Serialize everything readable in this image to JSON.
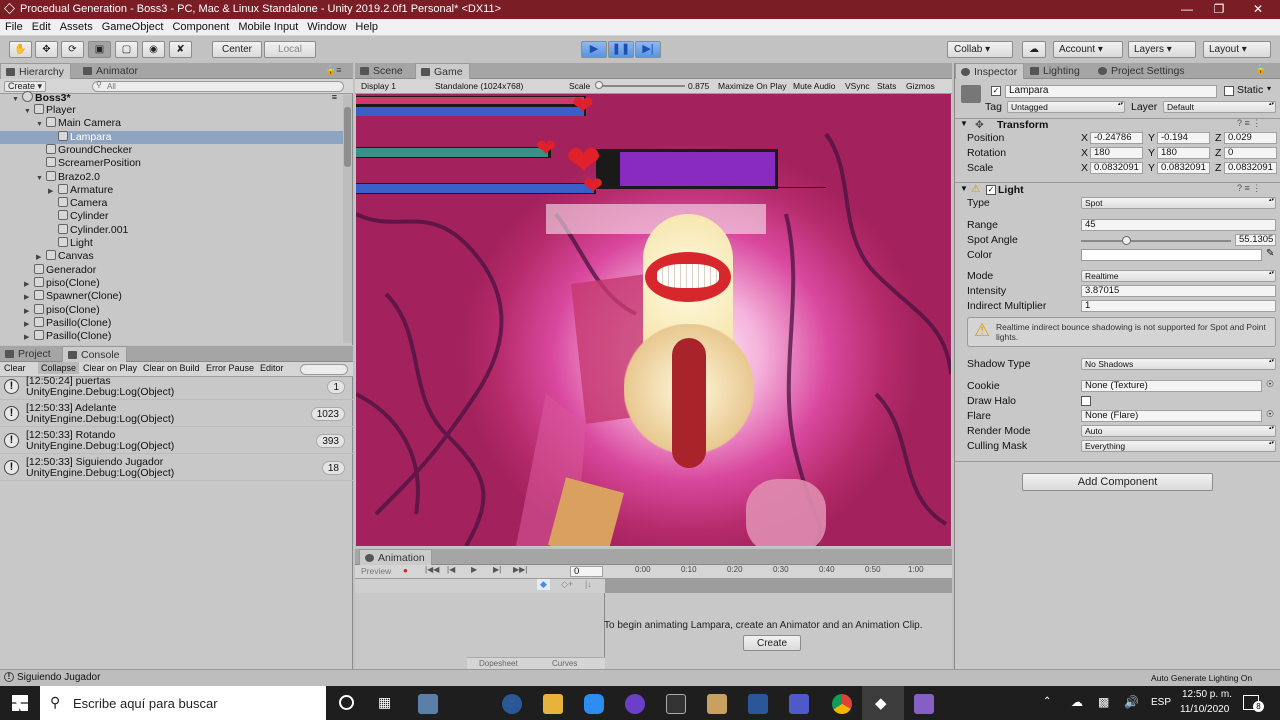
{
  "window": {
    "title": "Procedual Generation - Boss3 - PC, Mac & Linux Standalone - Unity 2019.2.0f1 Personal* <DX11>"
  },
  "menu": [
    "File",
    "Edit",
    "Assets",
    "GameObject",
    "Component",
    "Mobile Input",
    "Window",
    "Help"
  ],
  "toolbar": {
    "center": "Center",
    "local": "Local",
    "collab": "Collab",
    "account": "Account",
    "layers": "Layers",
    "layout": "Layout"
  },
  "hierarchy": {
    "tab": "Hierarchy",
    "tab2": "Animator",
    "create": "Create",
    "search_placeholder": "All",
    "scene": "Boss3*",
    "items": [
      {
        "label": "Player",
        "depth": 1,
        "arrow": "down"
      },
      {
        "label": "Main Camera",
        "depth": 2,
        "arrow": "down"
      },
      {
        "label": "Lampara",
        "depth": 3,
        "arrow": "",
        "selected": true
      },
      {
        "label": "GroundChecker",
        "depth": 2,
        "arrow": ""
      },
      {
        "label": "ScreamerPosition",
        "depth": 2,
        "arrow": ""
      },
      {
        "label": "Brazo2.0",
        "depth": 2,
        "arrow": "down"
      },
      {
        "label": "Armature",
        "depth": 3,
        "arrow": "right"
      },
      {
        "label": "Camera",
        "depth": 3,
        "arrow": ""
      },
      {
        "label": "Cylinder",
        "depth": 3,
        "arrow": ""
      },
      {
        "label": "Cylinder.001",
        "depth": 3,
        "arrow": ""
      },
      {
        "label": "Light",
        "depth": 3,
        "arrow": ""
      },
      {
        "label": "Canvas",
        "depth": 2,
        "arrow": "right"
      },
      {
        "label": "Generador",
        "depth": 1,
        "arrow": ""
      },
      {
        "label": "piso(Clone)",
        "depth": 1,
        "arrow": "right"
      },
      {
        "label": "Spawner(Clone)",
        "depth": 1,
        "arrow": "right"
      },
      {
        "label": "piso(Clone)",
        "depth": 1,
        "arrow": "right"
      },
      {
        "label": "Pasillo(Clone)",
        "depth": 1,
        "arrow": "right"
      },
      {
        "label": "Pasillo(Clone)",
        "depth": 1,
        "arrow": "right"
      }
    ]
  },
  "console": {
    "tab1": "Project",
    "tab2": "Console",
    "buttons": [
      "Clear",
      "Collapse",
      "Clear on Play",
      "Clear on Build",
      "Error Pause",
      "Editor"
    ],
    "entries": [
      {
        "time": "[12:50:24] puertas",
        "source": "UnityEngine.Debug:Log(Object)",
        "count": "1"
      },
      {
        "time": "[12:50:33] Adelante",
        "source": "UnityEngine.Debug:Log(Object)",
        "count": "1023"
      },
      {
        "time": "[12:50:33] Rotando",
        "source": "UnityEngine.Debug:Log(Object)",
        "count": "393"
      },
      {
        "time": "[12:50:33] Siguiendo Jugador",
        "source": "UnityEngine.Debug:Log(Object)",
        "count": "18"
      }
    ]
  },
  "game": {
    "tab_scene": "Scene",
    "tab_game": "Game",
    "display": "Display 1",
    "resolution": "Standalone (1024x768)",
    "scale_label": "Scale",
    "scale_value": "0.875",
    "options": [
      "Maximize On Play",
      "Mute Audio",
      "VSync",
      "Stats",
      "Gizmos"
    ]
  },
  "animation": {
    "tab": "Animation",
    "preview": "Preview",
    "frame": "0",
    "ticks": [
      "0:00",
      "0:10",
      "0:20",
      "0:30",
      "0:40",
      "0:50",
      "1:00"
    ],
    "message": "To begin animating Lampara, create an Animator and an Animation Clip.",
    "create": "Create",
    "dopesheet": "Dopesheet",
    "curves": "Curves"
  },
  "inspector": {
    "tabs": [
      "Inspector",
      "Lighting",
      "Project Settings"
    ],
    "name": "Lampara",
    "static": "Static",
    "tag_label": "Tag",
    "tag": "Untagged",
    "layer_label": "Layer",
    "layer": "Default",
    "transform": {
      "title": "Transform",
      "rows": [
        {
          "label": "Position",
          "x": "-0.24786",
          "y": "-0.194",
          "z": "0.029"
        },
        {
          "label": "Rotation",
          "x": "180",
          "y": "180",
          "z": "0"
        },
        {
          "label": "Scale",
          "x": "0.0832091",
          "y": "0.0832091",
          "z": "0.0832091"
        }
      ]
    },
    "light": {
      "title": "Light",
      "type_label": "Type",
      "type": "Spot",
      "range_label": "Range",
      "range": "45",
      "spot_label": "Spot Angle",
      "spot": "55.1305",
      "spot_fraction": 0.3,
      "color_label": "Color",
      "mode_label": "Mode",
      "mode": "Realtime",
      "intensity_label": "Intensity",
      "intensity": "3.87015",
      "indirect_label": "Indirect Multiplier",
      "indirect": "1",
      "warning": "Realtime indirect bounce shadowing is not supported for Spot and Point lights.",
      "shadow_label": "Shadow Type",
      "shadow": "No Shadows",
      "cookie_label": "Cookie",
      "cookie": "None (Texture)",
      "halo_label": "Draw Halo",
      "flare_label": "Flare",
      "flare": "None (Flare)",
      "render_label": "Render Mode",
      "render": "Auto",
      "culling_label": "Culling Mask",
      "culling": "Everything"
    },
    "add_component": "Add Component"
  },
  "status": {
    "left": "Siguiendo Jugador",
    "right": "Auto Generate Lighting On"
  },
  "taskbar": {
    "search": "Escribe aquí para buscar",
    "lang": "ESP",
    "time": "12:50 p. m.",
    "date": "11/10/2020",
    "notif": "8"
  },
  "colors": {
    "titlebar": "#7b1d25",
    "game_bg": "#b4276a",
    "health_blue": "#3a5fc8",
    "health_teal": "#3b8f88",
    "boss_purple": "#8a2bbf"
  }
}
